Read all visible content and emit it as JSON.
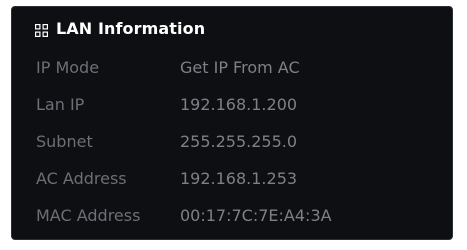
{
  "panel": {
    "title": "LAN Information",
    "icon": "grid-icon",
    "rows": [
      {
        "label": "IP Mode",
        "value": "Get IP From AC"
      },
      {
        "label": "Lan IP",
        "value": "192.168.1.200"
      },
      {
        "label": "Subnet",
        "value": "255.255.255.0"
      },
      {
        "label": "AC Address",
        "value": "192.168.1.253"
      },
      {
        "label": "MAC Address",
        "value": "00:17:7C:7E:A4:3A"
      }
    ]
  },
  "colors": {
    "panel_background": "#0d0f12",
    "title_text": "#ffffff",
    "label_text": "#6b6f76",
    "value_text": "#7d8187"
  }
}
